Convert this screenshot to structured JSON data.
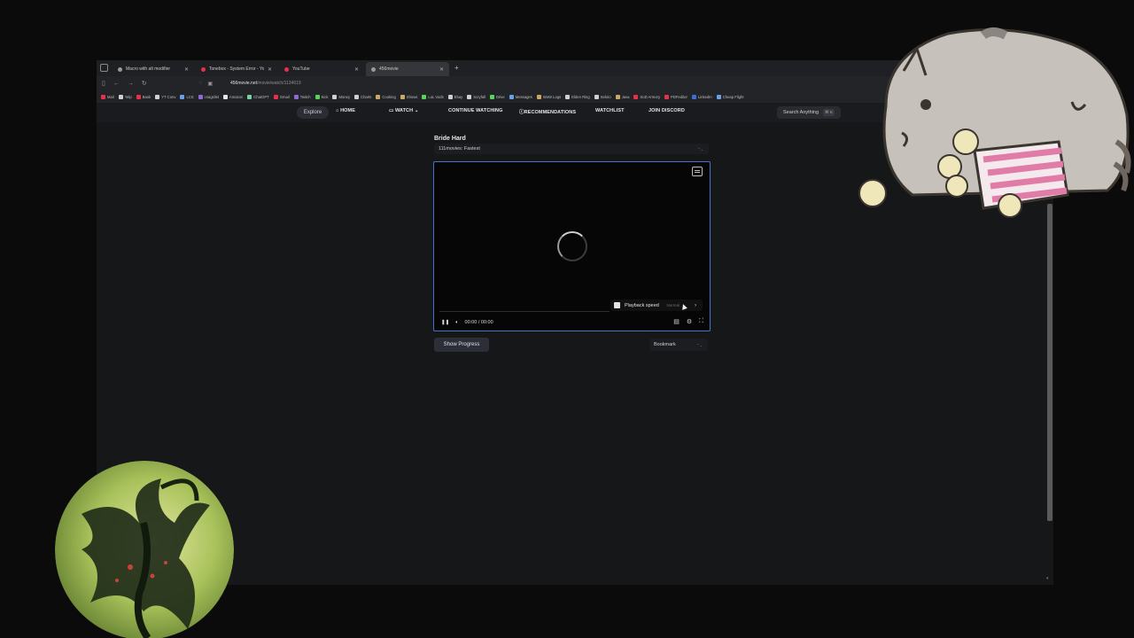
{
  "browser": {
    "tabs": [
      {
        "label": "Macro with alt modifier",
        "favicon_color": "#9a9a9a"
      },
      {
        "label": "Tonebox - System Error - YouT",
        "favicon_color": "#e8304a"
      },
      {
        "label": "YouTube",
        "favicon_color": "#e8304a"
      },
      {
        "label": "456movie",
        "favicon_color": "#9a9a9a"
      }
    ],
    "active_tab_index": 3,
    "new_tab": "+",
    "address": {
      "domain": "456movie.net",
      "path": "/movie/watch/1134619"
    },
    "bookmarks": [
      "Mail",
      "Yelp",
      "Bank",
      "YT Conv",
      "LCS",
      "craigslist",
      "Amazon",
      "ChatGPT",
      "Gmail",
      "Twitch",
      "Kick",
      "Money",
      "Charts",
      "Cooking",
      "Shows",
      "LoL Vods",
      "Ebay",
      "Scryfall",
      "Drive",
      "Messages",
      "WoW Logs",
      "Elden Ring",
      "Sekiro",
      "Java",
      "SoD Armory",
      "PDFeditor",
      "LinkedIn",
      "Cheap Flight"
    ]
  },
  "site": {
    "nav": {
      "explore": "Explore",
      "home": "HOME",
      "watch": "WATCH",
      "continue": "CONTINUE WATCHING",
      "recommendations": "RECOMMENDATIONS",
      "watchlist": "WATCHLIST",
      "discord": "JOIN DISCORD",
      "search": "Search Anything",
      "search_kbd": "⌘ K"
    },
    "movie_title": "Bride Hard",
    "server": "111movies: Fastest",
    "player": {
      "speed_label": "Playback speed",
      "speed_value": "Normal",
      "time": "00:00 / 00:00"
    },
    "show_progress": "Show Progress",
    "bookmark": "Bookmark"
  },
  "colors": {
    "accent": "#4a73c8",
    "background": "#161719"
  }
}
